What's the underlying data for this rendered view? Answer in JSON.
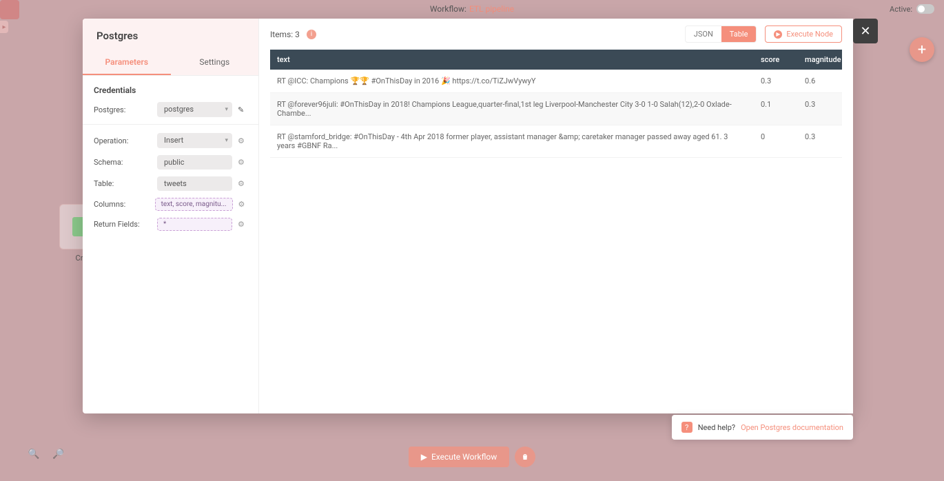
{
  "app": {
    "workflow_label": "Workflow:",
    "workflow_name": "ETL pipeline",
    "active_label": "Active:"
  },
  "background": {
    "card_label": "Cr...",
    "exec_workflow": "Execute Workflow"
  },
  "modal": {
    "title": "Postgres",
    "tabs": {
      "parameters": "Parameters",
      "settings": "Settings"
    },
    "credentials_title": "Credentials",
    "cred_row": {
      "label": "Postgres:",
      "value": "postgres"
    },
    "operation": {
      "label": "Operation:",
      "value": "Insert"
    },
    "schema": {
      "label": "Schema:",
      "value": "public"
    },
    "table": {
      "label": "Table:",
      "value": "tweets"
    },
    "columns": {
      "label": "Columns:",
      "value": "text, score, magnitu..."
    },
    "return_fields": {
      "label": "Return Fields:",
      "value": "*"
    },
    "items_label": "Items: 3",
    "view": {
      "json": "JSON",
      "table": "Table"
    },
    "execute_node": "Execute Node",
    "table_headers": {
      "text": "text",
      "score": "score",
      "magnitude": "magnitude"
    },
    "rows": [
      {
        "text": "RT @ICC: Champions 🏆🏆 #OnThisDay in 2016 🎉 https://t.co/TiZJwVywyY",
        "score": "0.3",
        "magnitude": "0.6"
      },
      {
        "text": "RT @forever96juli: #OnThisDay in 2018! Champions League,quarter-final,1st leg Liverpool-Manchester City 3-0 1-0 Salah(12),2-0 Oxlade-Chambe...",
        "score": "0.1",
        "magnitude": "0.3"
      },
      {
        "text": "RT @stamford_bridge: #OnThisDay - 4th Apr 2018 former player, assistant manager &amp; caretaker manager passed away aged 61. 3 years #GBNF Ra...",
        "score": "0",
        "magnitude": "0.3"
      }
    ]
  },
  "help": {
    "need": "Need help?",
    "link": "Open Postgres documentation"
  }
}
